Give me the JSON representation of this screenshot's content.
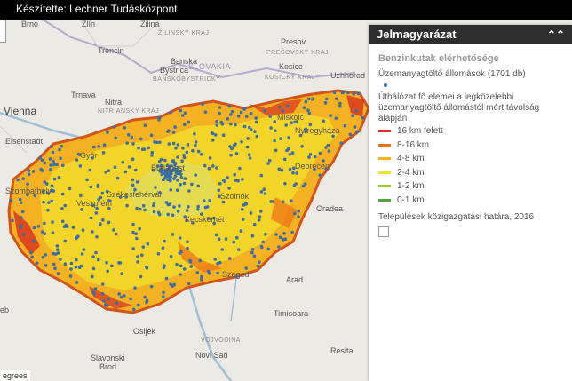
{
  "topbar": {
    "credit": "Készítette: Lechner Tudásközpont"
  },
  "map": {
    "attribution": "egrees",
    "labels": {
      "brno": "Brno",
      "zlin": "Zlín",
      "zilina": "Zilina",
      "presov": "Presov",
      "trencin": "Trencin",
      "banska": "Banska",
      "bystrica": "Bystrica",
      "kosice": "Kosice",
      "uzhhorod": "Uzhhorod",
      "trnava": "Trnava",
      "nitra": "Nitra",
      "vienna": "Vienna",
      "eisenstadt": "Eisenstadt",
      "miskolc": "Miskolc",
      "nyiregyhaza": "Nyíregyháza",
      "gyor": "Győr",
      "budapest": "Budapest",
      "debrecen": "Debrecen",
      "szombathely": "Szombathely",
      "szekesfehervar": "Székesfehérvár",
      "szolnok": "Szolnok",
      "veszprem": "Veszprém",
      "oradea": "Oradea",
      "kecskemet": "Kecskemét",
      "szeged": "Szeged",
      "arad": "Arad",
      "timisoara": "Timisoara",
      "osijek": "Osijek",
      "resita": "Resita",
      "novisad": "Novi Sad",
      "slavonski": "Slavonski",
      "brod": "Brod",
      "eb": "eb",
      "country_slovakia": "SLOVAKIA",
      "region_banskobystricky": "BANSKOBYSTRICKY",
      "region_kosicky": "KOŠICKÝ KRAJ",
      "region_nitriansky": "NITRIANSKY KRAJ",
      "region_zilinsky": "ŽILINSKÝ KRAJ",
      "region_presovsky": "PREŠOVSKÝ KRAJ",
      "region_vojvodina": "VOJVODINA"
    }
  },
  "legend": {
    "header": "Jelmagyarázat",
    "layer_title": "Benzinkutak elérhetősége",
    "stations_label": "Üzemanyagtöltő állomások (1701 db)",
    "distance_title": "Úthálózat fő elemei a legközelebbi üzemanyagtöltő állomástól mért távolság alapján",
    "classes": [
      {
        "label": "16 km felett",
        "color": "#d7301f"
      },
      {
        "label": "8-16 km",
        "color": "#ec7014"
      },
      {
        "label": "4-8 km",
        "color": "#f4b223"
      },
      {
        "label": "2-4 km",
        "color": "#f2e22b"
      },
      {
        "label": "1-2 km",
        "color": "#9dc93c"
      },
      {
        "label": "0-1 km",
        "color": "#4da838"
      }
    ],
    "boundary_label": "Települések közigazgatási határa, 2016"
  },
  "colors": {
    "station": "#3b6ea8",
    "country_fill": "#f5e9a8",
    "background": "#eceae4",
    "water": "#c8d8e6"
  }
}
